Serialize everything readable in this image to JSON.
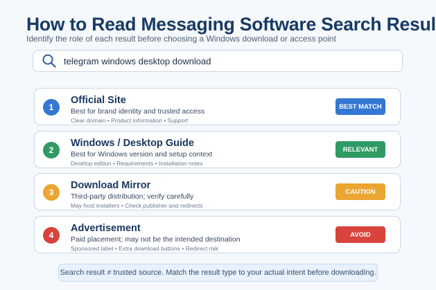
{
  "header": {
    "title": "How to Read Messaging Software Search Results",
    "subtitle": "Identify the role of each result before choosing a Windows download or access point"
  },
  "search": {
    "query": "telegram windows desktop download",
    "icon": "search-icon"
  },
  "results": [
    {
      "number": "1",
      "title": "Official Site",
      "description": "Best for brand identity and trusted access",
      "meta": "Clear domain • Product information • Support",
      "badge": "BEST MATCH",
      "color": "#3478d4"
    },
    {
      "number": "2",
      "title": "Windows / Desktop Guide",
      "description": "Best for Windows version and setup context",
      "meta": "Desktop edition • Requirements • Installation notes",
      "badge": "RELEVANT",
      "color": "#2e9a64"
    },
    {
      "number": "3",
      "title": "Download Mirror",
      "description": "Third-party distribution; verify carefully",
      "meta": "May host installers • Check publisher and redirects",
      "badge": "CAUTION",
      "color": "#eba531"
    },
    {
      "number": "4",
      "title": "Advertisement",
      "description": "Paid placement; may not be the intended destination",
      "meta": "Sponsored label • Extra download buttons • Redirect risk",
      "badge": "AVOID",
      "color": "#d8433e"
    }
  ],
  "footer": {
    "note": "Search result ≠ trusted source. Match the result type to your actual intent before downloading."
  }
}
